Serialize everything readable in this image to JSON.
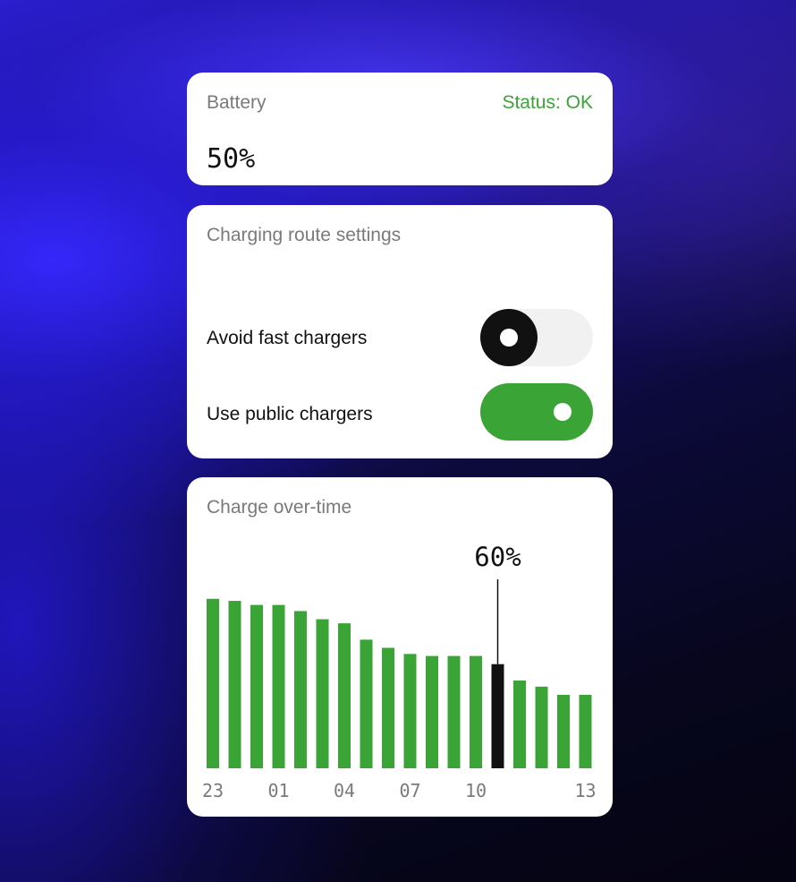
{
  "battery": {
    "title": "Battery",
    "status": "Status: OK",
    "value": "50%"
  },
  "settings": {
    "title": "Charging route settings",
    "rows": [
      {
        "label": "Avoid fast chargers",
        "enabled": false
      },
      {
        "label": "Use public chargers",
        "enabled": true
      }
    ]
  },
  "chart": {
    "title": "Charge over-time",
    "highlight_label": "60%"
  },
  "colors": {
    "accent": "#3aa536",
    "highlight": "#111111"
  },
  "chart_data": {
    "type": "bar",
    "ylim": [
      0,
      100
    ],
    "tick_labels": [
      "23",
      "01",
      "04",
      "07",
      "10",
      "13"
    ],
    "values": [
      83,
      82,
      80,
      80,
      77,
      73,
      71,
      63,
      59,
      56,
      55,
      55,
      55,
      51,
      43,
      40,
      36,
      36
    ],
    "highlight_index": 13,
    "highlight_value": "60%"
  }
}
